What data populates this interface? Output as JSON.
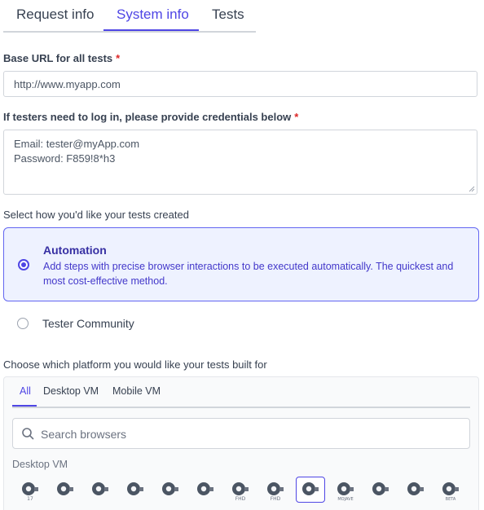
{
  "tabs": [
    {
      "label": "Request info",
      "active": false
    },
    {
      "label": "System info",
      "active": true
    },
    {
      "label": "Tests",
      "active": false
    }
  ],
  "base_url": {
    "label": "Base URL for all tests",
    "required_mark": "*",
    "value": "http://www.myapp.com"
  },
  "credentials": {
    "label": "If testers need to log in, please provide credentials below",
    "required_mark": "*",
    "line1": "Email: tester@myApp.com",
    "line2": "Password: F859!8*h3"
  },
  "creation": {
    "label": "Select how you'd like your tests created",
    "options": [
      {
        "title": "Automation",
        "description": "Add steps with precise browser interactions to be executed automatically. The quickest and most cost-effective method.",
        "selected": true
      },
      {
        "title": "Tester Community",
        "selected": false
      }
    ]
  },
  "platform": {
    "label": "Choose which platform you would like your tests built for",
    "tabs": [
      {
        "label": "All",
        "active": true
      },
      {
        "label": "Desktop VM",
        "active": false
      },
      {
        "label": "Mobile VM",
        "active": false
      }
    ],
    "search_placeholder": "Search browsers",
    "section": "Desktop VM",
    "browsers": [
      {
        "icon": "safari-17-icon",
        "badge": "17",
        "selected": false
      },
      {
        "icon": "edge-windows-icon",
        "badge": "",
        "selected": false
      },
      {
        "icon": "chrome-windows-icon",
        "badge": "",
        "selected": false
      },
      {
        "icon": "chrome-windows-icon",
        "badge": "",
        "selected": false
      },
      {
        "icon": "chrome-windows-icon",
        "badge": "",
        "selected": false
      },
      {
        "icon": "edge-windows-icon",
        "badge": "",
        "selected": false
      },
      {
        "icon": "edge-fhd-icon",
        "badge": "FHD",
        "selected": false
      },
      {
        "icon": "chrome-fhd-icon",
        "badge": "FHD",
        "selected": false
      },
      {
        "icon": "safari-mac-icon",
        "badge": "",
        "selected": true
      },
      {
        "icon": "safari-mojave-icon",
        "badge": "MOJAVE",
        "selected": false
      },
      {
        "icon": "edge-windows-icon",
        "badge": "",
        "selected": false
      },
      {
        "icon": "brave-windows-icon",
        "badge": "",
        "selected": false
      },
      {
        "icon": "chrome-beta-icon",
        "badge": "BETA",
        "selected": false
      }
    ]
  },
  "colors": {
    "accent": "#4f46e5",
    "required": "#dc2626",
    "card_bg": "#eef2ff"
  }
}
